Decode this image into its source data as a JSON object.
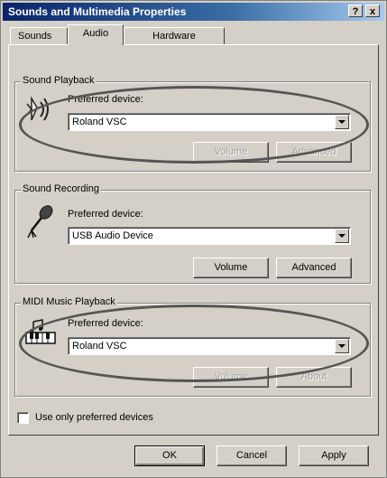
{
  "window": {
    "title": "Sounds and Multimedia Properties",
    "help_btn": "?",
    "close_btn": "x"
  },
  "tabs": [
    {
      "label": "Sounds",
      "active": false
    },
    {
      "label": "Audio",
      "active": true
    },
    {
      "label": "Hardware",
      "active": false
    }
  ],
  "playback": {
    "group_label": "Sound Playback",
    "pref_label": "Preferred device:",
    "device": "Roland VSC",
    "volume_btn": "Volume",
    "advanced_btn": "Advanced"
  },
  "recording": {
    "group_label": "Sound Recording",
    "pref_label": "Preferred device:",
    "device": "USB Audio Device",
    "volume_btn": "Volume",
    "advanced_btn": "Advanced"
  },
  "midi": {
    "group_label": "MIDI Music Playback",
    "pref_label": "Preferred device:",
    "device": "Roland VSC",
    "volume_btn": "Volume",
    "about_btn": "About"
  },
  "use_only_preferred": {
    "label": "Use only preferred devices",
    "checked": false
  },
  "footer": {
    "ok": "OK",
    "cancel": "Cancel",
    "apply": "Apply"
  },
  "icons": [
    "speaker-icon",
    "microphone-icon",
    "midi-keyboard-icon"
  ]
}
